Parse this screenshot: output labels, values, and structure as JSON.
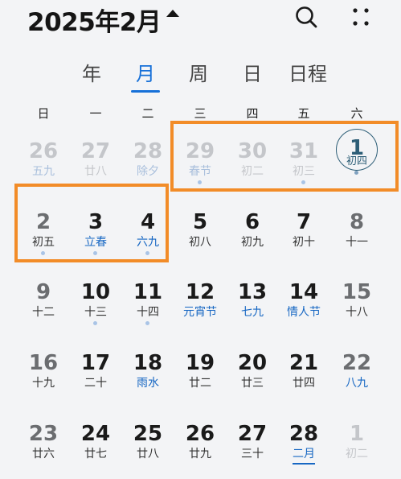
{
  "header": {
    "title": "2025年2月",
    "icons": [
      "caret-up-icon",
      "search-icon",
      "more-icon"
    ]
  },
  "tabs": [
    {
      "label": "年",
      "active": false
    },
    {
      "label": "月",
      "active": true
    },
    {
      "label": "周",
      "active": false
    },
    {
      "label": "日",
      "active": false
    },
    {
      "label": "日程",
      "active": false
    }
  ],
  "weekdays": [
    "日",
    "一",
    "二",
    "三",
    "四",
    "五",
    "六"
  ],
  "weeks": [
    [
      {
        "num": "26",
        "sub": "五九",
        "muted": true,
        "blue": true
      },
      {
        "num": "27",
        "sub": "廿八",
        "muted": true
      },
      {
        "num": "28",
        "sub": "除夕",
        "muted": true,
        "blue": true
      },
      {
        "num": "29",
        "sub": "春节",
        "muted": true,
        "blue": true,
        "dot": true
      },
      {
        "num": "30",
        "sub": "初二",
        "muted": true
      },
      {
        "num": "31",
        "sub": "初三",
        "muted": true,
        "dot": true
      },
      {
        "num": "1",
        "sub": "初四",
        "today": true,
        "dot": true
      }
    ],
    [
      {
        "num": "2",
        "sub": "初五",
        "weekend": true,
        "dot": true
      },
      {
        "num": "3",
        "sub": "立春",
        "blue": true,
        "dot": true
      },
      {
        "num": "4",
        "sub": "六九",
        "blue": true,
        "dot": true
      },
      {
        "num": "5",
        "sub": "初八"
      },
      {
        "num": "6",
        "sub": "初九"
      },
      {
        "num": "7",
        "sub": "初十"
      },
      {
        "num": "8",
        "sub": "十一",
        "weekend": true
      }
    ],
    [
      {
        "num": "9",
        "sub": "十二",
        "weekend": true
      },
      {
        "num": "10",
        "sub": "十三",
        "dot": true
      },
      {
        "num": "11",
        "sub": "十四",
        "dot": true
      },
      {
        "num": "12",
        "sub": "元宵节",
        "blue": true
      },
      {
        "num": "13",
        "sub": "七九",
        "blue": true
      },
      {
        "num": "14",
        "sub": "情人节",
        "blue": true
      },
      {
        "num": "15",
        "sub": "十八",
        "weekend": true
      }
    ],
    [
      {
        "num": "16",
        "sub": "十九",
        "weekend": true
      },
      {
        "num": "17",
        "sub": "二十"
      },
      {
        "num": "18",
        "sub": "雨水",
        "blue": true
      },
      {
        "num": "19",
        "sub": "廿二"
      },
      {
        "num": "20",
        "sub": "廿三"
      },
      {
        "num": "21",
        "sub": "廿四"
      },
      {
        "num": "22",
        "sub": "八九",
        "weekend": true,
        "blue": true
      }
    ],
    [
      {
        "num": "23",
        "sub": "廿六",
        "weekend": true
      },
      {
        "num": "24",
        "sub": "廿七"
      },
      {
        "num": "25",
        "sub": "廿八"
      },
      {
        "num": "26",
        "sub": "廿九"
      },
      {
        "num": "27",
        "sub": "三十"
      },
      {
        "num": "28",
        "sub": "二月",
        "blue": true,
        "underline": true
      },
      {
        "num": "1",
        "sub": "初二",
        "muted": true
      }
    ]
  ],
  "colors": {
    "accent": "#1670d8",
    "highlight": "#f28c28",
    "today_ring": "#2d5e77",
    "muted": "#c4c6ca"
  }
}
